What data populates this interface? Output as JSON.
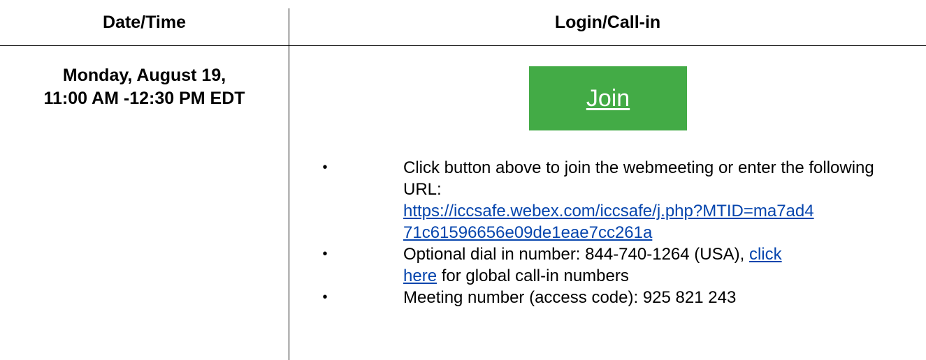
{
  "table": {
    "headers": {
      "date_time": "Date/Time",
      "login_call_in": "Login/Call-in"
    },
    "date": {
      "line1": "Monday, August 19,",
      "line2": "11:00 AM -12:30 PM EDT"
    },
    "join_button": {
      "label": "Join",
      "color": "#43ab46"
    },
    "items": [
      {
        "text": "Click button above to join the webmeeting or enter the following URL:",
        "link_line1": "https://iccsafe.webex.com/iccsafe/j.php?MTID=ma7ad4",
        "link_line2": "71c61596656e09de1eae7cc261a"
      },
      {
        "text_before": "Optional dial in number: 844-740-1264 (USA), ",
        "link_text_line1": "click",
        "link_text_line2": "here",
        "text_after": " for global call-in numbers"
      },
      {
        "text": "Meeting number (access code): 925 821 243"
      }
    ],
    "bullet_glyph": "•",
    "link_color": "#0645ad"
  }
}
